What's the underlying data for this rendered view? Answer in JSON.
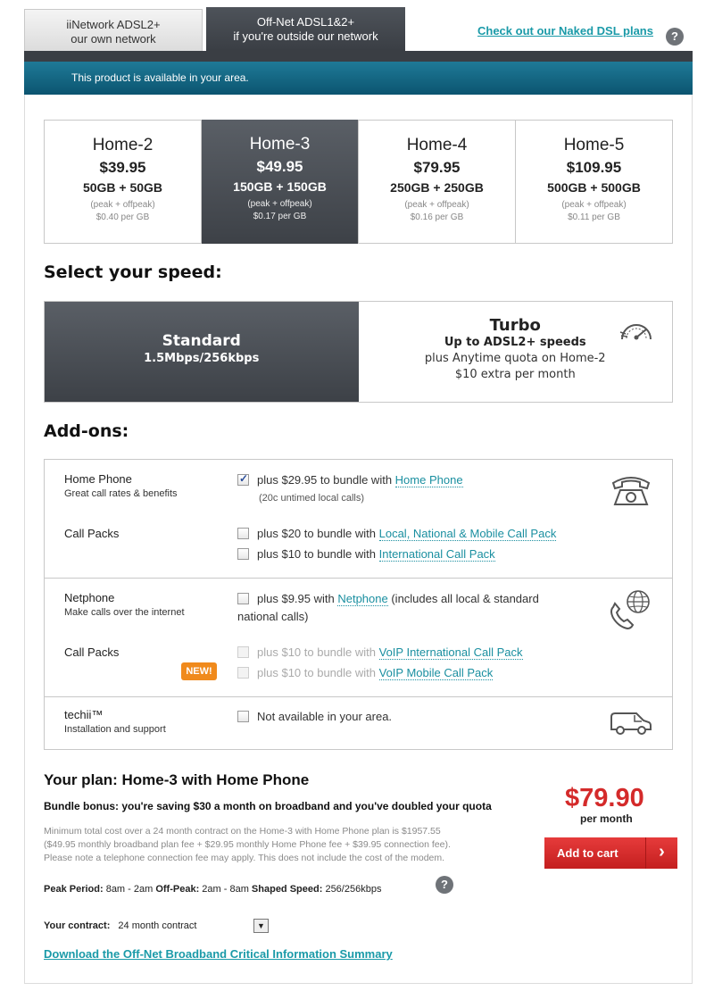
{
  "tabs": [
    {
      "title": "iiNetwork ADSL2+",
      "subtitle": "our own network"
    },
    {
      "title": "Off-Net ADSL1&2+",
      "subtitle": "if you're outside our network"
    }
  ],
  "header": {
    "naked_link": "Check out our Naked DSL plans",
    "help_icon": "?",
    "availability": "This product is available in your area."
  },
  "plans": [
    {
      "name": "Home-2",
      "price": "$39.95",
      "quota": "50GB + 50GB",
      "note": "(peak + offpeak)",
      "per_gb": "$0.40 per GB"
    },
    {
      "name": "Home-3",
      "price": "$49.95",
      "quota": "150GB + 150GB",
      "note": "(peak + offpeak)",
      "per_gb": "$0.17 per GB"
    },
    {
      "name": "Home-4",
      "price": "$79.95",
      "quota": "250GB + 250GB",
      "note": "(peak + offpeak)",
      "per_gb": "$0.16 per GB"
    },
    {
      "name": "Home-5",
      "price": "$109.95",
      "quota": "500GB + 500GB",
      "note": "(peak + offpeak)",
      "per_gb": "$0.11 per GB"
    }
  ],
  "speed_section": {
    "heading": "Select your speed:",
    "standard": {
      "name": "Standard",
      "sub": "1.5Mbps/256kbps"
    },
    "turbo": {
      "name": "Turbo",
      "sub": "Up to ADSL2+ speeds",
      "line1": "plus Anytime quota on Home-2",
      "line2": "$10 extra per month"
    }
  },
  "addons": {
    "heading": "Add-ons:",
    "home_phone": {
      "title": "Home Phone",
      "sub": "Great call rates & benefits",
      "opt_text": "plus $29.95 to bundle with ",
      "opt_link": "Home Phone",
      "opt_note": "(20c untimed local calls)"
    },
    "call_packs_1": {
      "title": "Call Packs",
      "opt1_text": "plus $20 to bundle with ",
      "opt1_link": "Local, National & Mobile Call Pack",
      "opt2_text": "plus $10 to bundle with ",
      "opt2_link": "International Call Pack"
    },
    "netphone": {
      "title": "Netphone",
      "sub": "Make calls over the internet",
      "opt_text": "plus $9.95 with ",
      "opt_link": "Netphone",
      "opt_after": " (includes all local & standard",
      "opt_line2": "national calls)"
    },
    "call_packs_2": {
      "title": "Call Packs",
      "badge": "NEW!",
      "opt1_text": "plus $10 to bundle with ",
      "opt1_link": "VoIP International Call Pack",
      "opt2_text": "plus $10 to bundle with ",
      "opt2_link": "VoIP Mobile Call Pack"
    },
    "techii": {
      "title": "techii™",
      "sub": "Installation and support",
      "opt_text": "Not available in your area."
    }
  },
  "summary": {
    "plan_title": "Your plan: Home-3 with Home Phone",
    "bonus": "Bundle bonus: you're saving $30 a month on broadband and you've doubled your quota",
    "fine1": "Minimum total cost over a 24 month contract on the Home-3 with Home Phone plan is $1957.55",
    "fine2": "($49.95 monthly broadband plan fee + $29.95 monthly Home Phone fee + $39.95 connection fee).",
    "fine3": "Please note a telephone connection fee may apply. This does not include the cost of the modem.",
    "price": "$79.90",
    "per_month": "per month",
    "cart_label": "Add to cart",
    "cart_arrow": "›",
    "peak_label": "Peak Period:",
    "peak_value": " 8am - 2am ",
    "offpeak_label": "Off-Peak:",
    "offpeak_value": " 2am - 8am ",
    "shaped_label": "Shaped Speed:",
    "shaped_value": " 256/256kbps",
    "contract_label": "Your contract:",
    "contract_value": "24 month contract",
    "dropdown_glyph": "▼",
    "cis_link": "Download the Off-Net Broadband Critical Information Summary"
  }
}
